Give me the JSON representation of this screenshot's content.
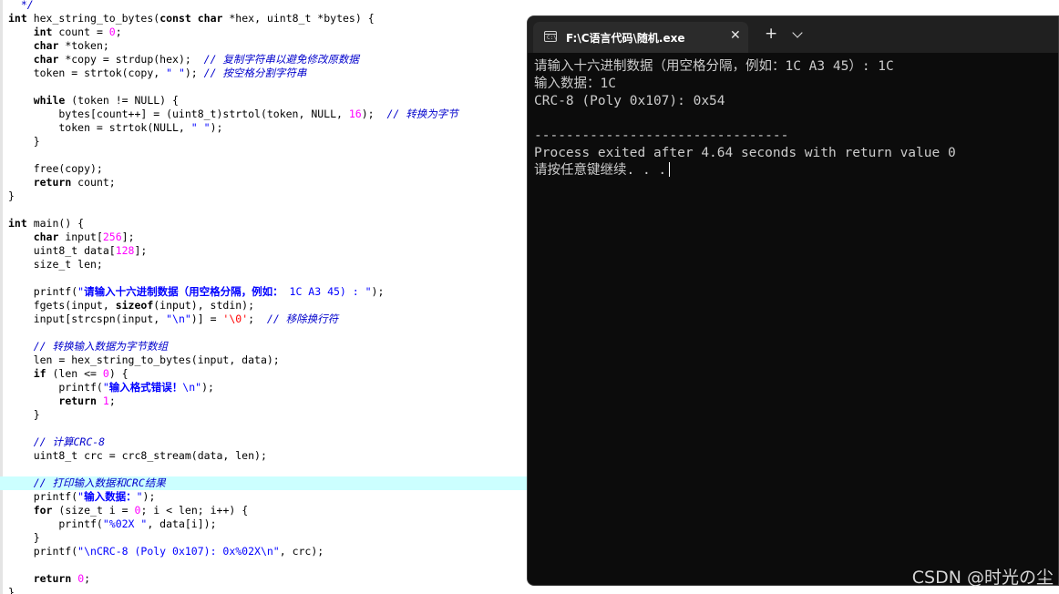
{
  "editor": {
    "lines": [
      [
        [
          "c",
          "  */"
        ]
      ],
      [
        [
          "k",
          "int"
        ],
        [
          "t",
          " hex_string_to_bytes("
        ],
        [
          "k",
          "const"
        ],
        [
          "t",
          " "
        ],
        [
          "k",
          "char"
        ],
        [
          "t",
          " *hex, uint8_t *bytes) {"
        ]
      ],
      [
        [
          "t",
          "    "
        ],
        [
          "k",
          "int"
        ],
        [
          "t",
          " count = "
        ],
        [
          "n",
          "0"
        ],
        [
          "t",
          ";"
        ]
      ],
      [
        [
          "t",
          "    "
        ],
        [
          "k",
          "char"
        ],
        [
          "t",
          " *token;"
        ]
      ],
      [
        [
          "t",
          "    "
        ],
        [
          "k",
          "char"
        ],
        [
          "t",
          " *copy = strdup(hex);  "
        ],
        [
          "c",
          "// 复制字符串以避免修改原数据"
        ]
      ],
      [
        [
          "t",
          "    token = strtok(copy, "
        ],
        [
          "s",
          "\" \""
        ],
        [
          "t",
          "); "
        ],
        [
          "c",
          "// 按空格分割字符串"
        ]
      ],
      [],
      [
        [
          "t",
          "    "
        ],
        [
          "k",
          "while"
        ],
        [
          "t",
          " (token != NULL) {"
        ]
      ],
      [
        [
          "t",
          "        bytes[count++] = (uint8_t)strtol(token, NULL, "
        ],
        [
          "n",
          "16"
        ],
        [
          "t",
          ");  "
        ],
        [
          "c",
          "// 转换为字节"
        ]
      ],
      [
        [
          "t",
          "        token = strtok(NULL, "
        ],
        [
          "s",
          "\" \""
        ],
        [
          "t",
          ");"
        ]
      ],
      [
        [
          "t",
          "    }"
        ]
      ],
      [],
      [
        [
          "t",
          "    free(copy);"
        ]
      ],
      [
        [
          "t",
          "    "
        ],
        [
          "k",
          "return"
        ],
        [
          "t",
          " count;"
        ]
      ],
      [
        [
          "t",
          "}"
        ]
      ],
      [],
      [
        [
          "k",
          "int"
        ],
        [
          "t",
          " main() {"
        ]
      ],
      [
        [
          "t",
          "    "
        ],
        [
          "k",
          "char"
        ],
        [
          "t",
          " input["
        ],
        [
          "n",
          "256"
        ],
        [
          "t",
          "];"
        ]
      ],
      [
        [
          "t",
          "    uint8_t data["
        ],
        [
          "n",
          "128"
        ],
        [
          "t",
          "];"
        ]
      ],
      [
        [
          "t",
          "    size_t len;"
        ]
      ],
      [],
      [
        [
          "t",
          "    printf("
        ],
        [
          "s",
          "\""
        ],
        [
          "sb",
          "请输入十六进制数据（用空格分隔，例如："
        ],
        [
          "s",
          " 1C A3 45) : \""
        ],
        [
          "t",
          ");"
        ]
      ],
      [
        [
          "t",
          "    fgets(input, "
        ],
        [
          "k",
          "sizeof"
        ],
        [
          "t",
          "(input), stdin);"
        ]
      ],
      [
        [
          "t",
          "    input[strcspn(input, "
        ],
        [
          "s",
          "\"\\n\""
        ],
        [
          "t",
          ")] = "
        ],
        [
          "p",
          "'\\0'"
        ],
        [
          "t",
          ";  "
        ],
        [
          "c",
          "// 移除换行符"
        ]
      ],
      [],
      [
        [
          "t",
          "    "
        ],
        [
          "c",
          "// 转换输入数据为字节数组"
        ]
      ],
      [
        [
          "t",
          "    len = hex_string_to_bytes(input, data);"
        ]
      ],
      [
        [
          "t",
          "    "
        ],
        [
          "k",
          "if"
        ],
        [
          "t",
          " (len <= "
        ],
        [
          "n",
          "0"
        ],
        [
          "t",
          ") {"
        ]
      ],
      [
        [
          "t",
          "        printf("
        ],
        [
          "s",
          "\""
        ],
        [
          "sb",
          "输入格式错误！"
        ],
        [
          "s",
          "\\n\""
        ],
        [
          "t",
          ");"
        ]
      ],
      [
        [
          "t",
          "        "
        ],
        [
          "k",
          "return"
        ],
        [
          "t",
          " "
        ],
        [
          "n",
          "1"
        ],
        [
          "t",
          ";"
        ]
      ],
      [
        [
          "t",
          "    }"
        ]
      ],
      [],
      [
        [
          "t",
          "    "
        ],
        [
          "c",
          "// 计算CRC-8"
        ]
      ],
      [
        [
          "t",
          "    uint8_t crc = crc8_stream(data, len);"
        ]
      ],
      [],
      [
        [
          "t",
          "    "
        ],
        [
          "c",
          "// 打印输入数据和CRC结果"
        ]
      ],
      [
        [
          "t",
          "    printf("
        ],
        [
          "s",
          "\""
        ],
        [
          "sb",
          "输入数据："
        ],
        [
          "s",
          "\""
        ],
        [
          "t",
          ");"
        ]
      ],
      [
        [
          "t",
          "    "
        ],
        [
          "k",
          "for"
        ],
        [
          "t",
          " (size_t i = "
        ],
        [
          "n",
          "0"
        ],
        [
          "t",
          "; i < len; i++) {"
        ]
      ],
      [
        [
          "t",
          "        printf("
        ],
        [
          "s",
          "\"%02X \""
        ],
        [
          "t",
          ", data[i]);"
        ]
      ],
      [
        [
          "t",
          "    }"
        ]
      ],
      [
        [
          "t",
          "    printf("
        ],
        [
          "s",
          "\"\\nCRC-8 (Poly 0x107): 0x%02X\\n\""
        ],
        [
          "t",
          ", crc);"
        ]
      ],
      [],
      [
        [
          "t",
          "    "
        ],
        [
          "k",
          "return"
        ],
        [
          "t",
          " "
        ],
        [
          "n",
          "0"
        ],
        [
          "t",
          ";"
        ]
      ],
      [
        [
          "t",
          "}"
        ]
      ]
    ],
    "highlight_index": 35
  },
  "console": {
    "tab_title": "F:\\C语言代码\\随机.exe",
    "icon_text": "C:\\",
    "close_glyph": "✕",
    "new_tab_glyph": "+",
    "output": [
      "请输入十六进制数据（用空格分隔，例如：1C A3 45）: 1C",
      "输入数据：1C",
      "CRC-8 (Poly 0x107): 0x54",
      "",
      "--------------------------------",
      "Process exited after 4.64 seconds with return value 0",
      "请按任意键继续. . ."
    ]
  },
  "watermark": "CSDN @时光の尘"
}
